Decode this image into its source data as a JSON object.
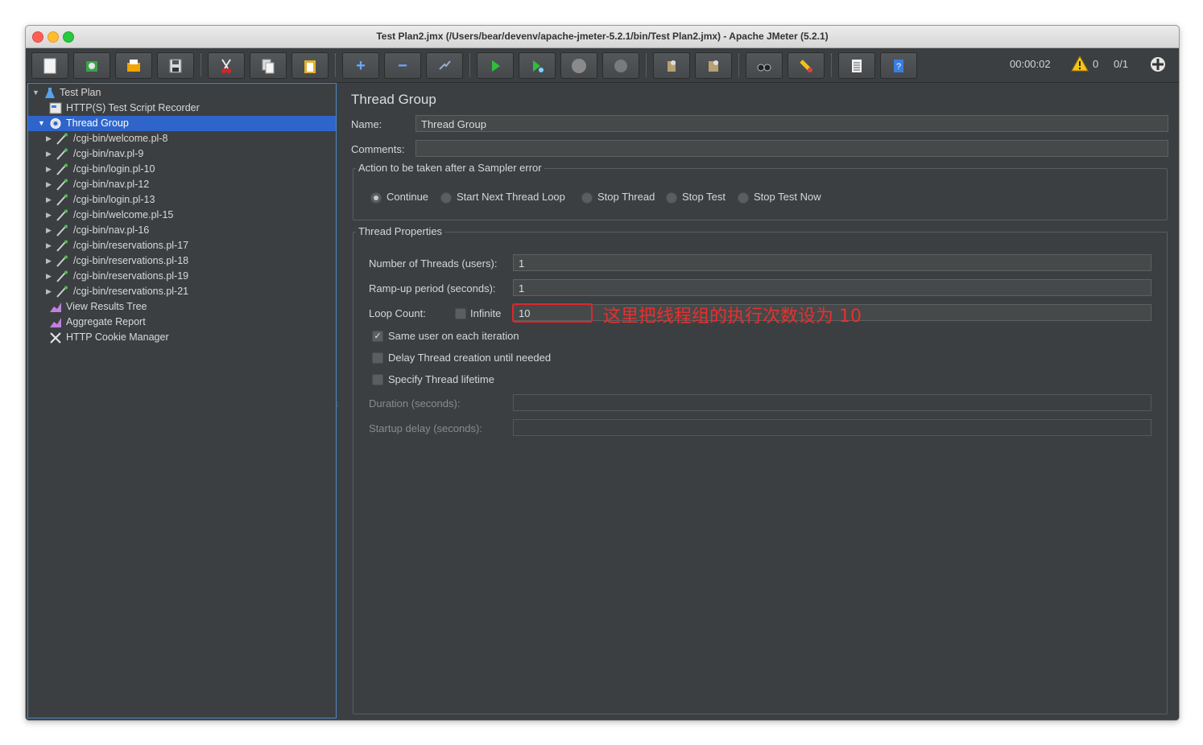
{
  "window": {
    "title": "Test Plan2.jmx (/Users/bear/devenv/apache-jmeter-5.2.1/bin/Test Plan2.jmx) - Apache JMeter (5.2.1)"
  },
  "toolbar": {
    "elapsed_time": "00:00:02",
    "warning_count": "0",
    "thread_count": "0/1"
  },
  "tree": {
    "test_plan": "Test Plan",
    "recorder": "HTTP(S) Test Script Recorder",
    "thread_group": "Thread Group",
    "samplers": [
      "/cgi-bin/welcome.pl-8",
      "/cgi-bin/nav.pl-9",
      "/cgi-bin/login.pl-10",
      "/cgi-bin/nav.pl-12",
      "/cgi-bin/login.pl-13",
      "/cgi-bin/welcome.pl-15",
      "/cgi-bin/nav.pl-16",
      "/cgi-bin/reservations.pl-17",
      "/cgi-bin/reservations.pl-18",
      "/cgi-bin/reservations.pl-19",
      "/cgi-bin/reservations.pl-21"
    ],
    "listeners": [
      "View Results Tree",
      "Aggregate Report",
      "HTTP Cookie Manager"
    ]
  },
  "panel": {
    "title": "Thread Group",
    "name_label": "Name:",
    "name_value": "Thread Group",
    "comments_label": "Comments:",
    "comments_value": "",
    "action_group_title": "Action to be taken after a Sampler error",
    "actions": [
      "Continue",
      "Start Next Thread Loop",
      "Stop Thread",
      "Stop Test",
      "Stop Test Now"
    ],
    "selected_action": "Continue",
    "props_group_title": "Thread Properties",
    "threads_label": "Number of Threads (users):",
    "threads_value": "1",
    "rampup_label": "Ramp-up period (seconds):",
    "rampup_value": "1",
    "loop_label": "Loop Count:",
    "infinite_label": "Infinite",
    "loop_value": "10",
    "same_user_label": "Same user on each iteration",
    "delay_label": "Delay Thread creation until needed",
    "lifetime_label": "Specify Thread lifetime",
    "duration_label": "Duration (seconds):",
    "startup_label": "Startup delay (seconds):"
  },
  "annotation": {
    "text": "这里把线程组的执行次数设为 10"
  },
  "colors": {
    "accent": "#2f65ca",
    "annotation": "#e0262a",
    "background": "#3c3f41"
  }
}
